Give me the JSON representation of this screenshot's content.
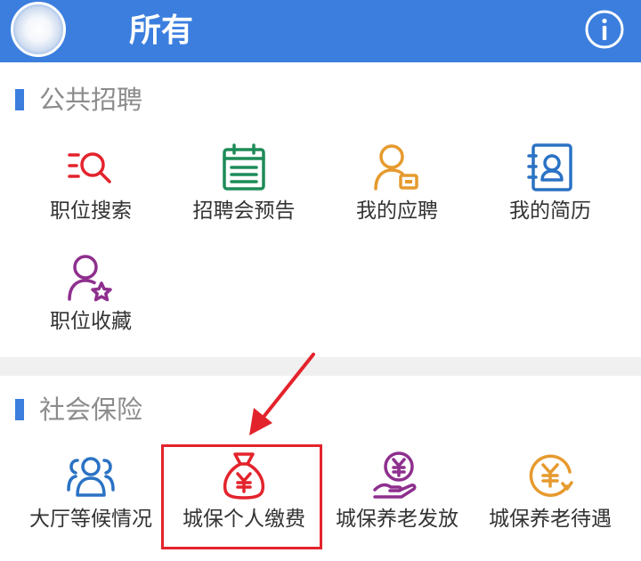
{
  "header": {
    "title": "所有",
    "info_icon": "info-icon",
    "avatar_icon": "avatar"
  },
  "sections": [
    {
      "title": "公共招聘",
      "items": [
        {
          "label": "职位搜索",
          "icon": "list-search-icon",
          "color": "#e3232c"
        },
        {
          "label": "招聘会预告",
          "icon": "calendar-icon",
          "color": "#1e8c58"
        },
        {
          "label": "我的应聘",
          "icon": "user-badge-icon",
          "color": "#e69a2e"
        },
        {
          "label": "我的简历",
          "icon": "resume-icon",
          "color": "#2a72c4"
        },
        {
          "label": "职位收藏",
          "icon": "user-star-icon",
          "color": "#8e2f8e"
        }
      ]
    },
    {
      "title": "社会保险",
      "items": [
        {
          "label": "大厅等候情况",
          "icon": "group-icon",
          "color": "#2a72c4"
        },
        {
          "label": "城保个人缴费",
          "icon": "money-bag-yuan-icon",
          "color": "#e3232c"
        },
        {
          "label": "城保养老发放",
          "icon": "hand-yuan-icon",
          "color": "#8e2f8e"
        },
        {
          "label": "城保养老待遇",
          "icon": "yuan-refresh-icon",
          "color": "#e69a2e"
        }
      ]
    }
  ],
  "annotation": {
    "highlight_color": "#e3232c",
    "highlighted_item": "城保个人缴费"
  },
  "colors": {
    "header_bg": "#3b7ede",
    "section_bar": "#3b7ede",
    "section_title": "#8c8c8c",
    "label": "#333333"
  }
}
